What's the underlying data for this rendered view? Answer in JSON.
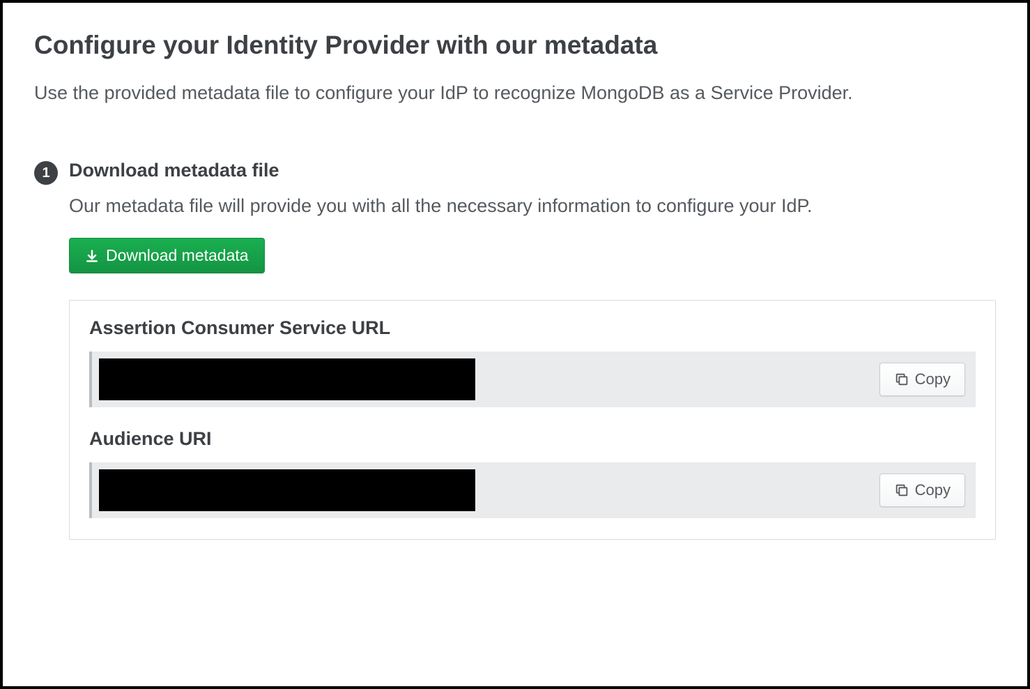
{
  "header": {
    "title": "Configure your Identity Provider with our metadata",
    "description": "Use the provided metadata file to configure your IdP to recognize MongoDB as a Service Provider."
  },
  "step": {
    "number": "1",
    "title": "Download metadata file",
    "description": "Our metadata file will provide you with all the necessary information to configure your IdP.",
    "download_button_label": "Download metadata"
  },
  "fields": {
    "acs": {
      "label": "Assertion Consumer Service URL",
      "copy_label": "Copy"
    },
    "audience": {
      "label": "Audience URI",
      "copy_label": "Copy"
    }
  }
}
